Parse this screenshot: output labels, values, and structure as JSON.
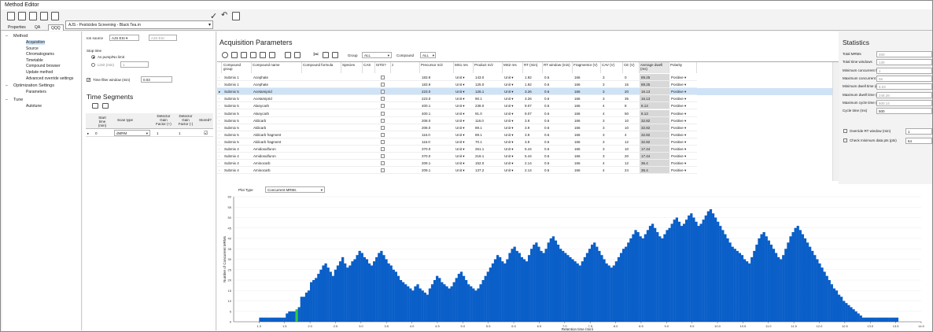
{
  "window_title": "Method Editor",
  "method_name": "AJS - Pesticides Screening - Black Tea.m",
  "tabs": [
    "Properties",
    "QA",
    "QQQ"
  ],
  "nav": [
    {
      "label": "Method",
      "level": 0,
      "expander": "–"
    },
    {
      "label": "Acquisition",
      "level": 1,
      "selected": true
    },
    {
      "label": "Source",
      "level": 1
    },
    {
      "label": "Chromatograms",
      "level": 1
    },
    {
      "label": "Timetable",
      "level": 1
    },
    {
      "label": "Compound browser",
      "level": 1
    },
    {
      "label": "Update method",
      "level": 1
    },
    {
      "label": "Advanced override settings",
      "level": 1
    },
    {
      "label": "Optimization Settings",
      "level": 0,
      "expander": "–"
    },
    {
      "label": "Parameters",
      "level": 1
    },
    {
      "label": "Tune",
      "level": 0,
      "expander": "–"
    },
    {
      "label": "Autotune",
      "level": 1
    }
  ],
  "settings": {
    "ion_source_label": "Ion source",
    "ion_source_value": "AJS ESI",
    "ion_source_value2": "AJS ESI",
    "stop_time_label": "Stop time",
    "stop_opt1": "As pump/No limit",
    "stop_opt2": "Limit (min)",
    "stop_limit_value": "1",
    "time_filter_label": "Time filter window (min)",
    "time_filter_value": "0.03"
  },
  "time_segments": {
    "title": "Time Segments",
    "headers": [
      "Start time (min)",
      "Scan type",
      "Detector Gain Factor (+)",
      "Detector Gain Factor (-)",
      "Stored?"
    ],
    "row": {
      "start": "0",
      "scan": "dMRM",
      "gain_pos": "1",
      "gain_neg": "1",
      "stored": "☑"
    }
  },
  "acq": {
    "title": "Acquisition Parameters",
    "group_label": "Group",
    "group_value": "ALL",
    "compound_label": "Compound",
    "compound_value": "ALL",
    "headers": [
      "Compound group",
      "Compound name",
      "Compound formula",
      "Species",
      "CAS",
      "ISTD?",
      "z",
      "Precursor m/z",
      "MS1 res",
      "Product m/z",
      "MS2 res",
      "RT (min)",
      "RT window (min)",
      "Fragmentor (V)",
      "CAV (V)",
      "CE (V)",
      "Average dwell (ms)",
      "Polarity"
    ],
    "rows": [
      {
        "group": "Submix 1",
        "name": "Acephate",
        "prec": "183.9",
        "ms1": "Unit",
        "prod": "143.0",
        "ms2": "Unit",
        "rt": "1.92",
        "rtw": "0.6",
        "frag": "166",
        "cav": "3",
        "ce": "0",
        "dwell": "89.25",
        "pol": "Positive"
      },
      {
        "group": "Submix 1",
        "name": "Acephate",
        "prec": "183.9",
        "ms1": "Unit",
        "prod": "125.0",
        "ms2": "Unit",
        "rt": "1.92",
        "rtw": "0.6",
        "frag": "166",
        "cav": "3",
        "ce": "15",
        "dwell": "89.25",
        "pol": "Positive"
      },
      {
        "group": "Submix 5",
        "name": "Acetamiprid",
        "prec": "223.0",
        "ms1": "Unit",
        "prod": "126.1",
        "ms2": "Unit",
        "rt": "3.26",
        "rtw": "0.6",
        "frag": "166",
        "cav": "3",
        "ce": "20",
        "dwell": "16.13",
        "pol": "Positive",
        "selected": true
      },
      {
        "group": "Submix 5",
        "name": "Acetamiprid",
        "prec": "223.0",
        "ms1": "Unit",
        "prod": "90.1",
        "ms2": "Unit",
        "rt": "3.26",
        "rtw": "0.6",
        "frag": "166",
        "cav": "3",
        "ce": "35",
        "dwell": "16.13",
        "pol": "Positive"
      },
      {
        "group": "Submix 5",
        "name": "Alanycarb",
        "prec": "400.1",
        "ms1": "Unit",
        "prod": "238.0",
        "ms2": "Unit",
        "rt": "9.07",
        "rtw": "0.6",
        "frag": "166",
        "cav": "4",
        "ce": "8",
        "dwell": "8.13",
        "pol": "Positive"
      },
      {
        "group": "Submix 5",
        "name": "Alanycarb",
        "prec": "400.1",
        "ms1": "Unit",
        "prod": "91.0",
        "ms2": "Unit",
        "rt": "9.07",
        "rtw": "0.6",
        "frag": "166",
        "cav": "4",
        "ce": "50",
        "dwell": "8.13",
        "pol": "Positive"
      },
      {
        "group": "Submix 5",
        "name": "Aldicarb",
        "prec": "208.0",
        "ms1": "Unit",
        "prod": "116.0",
        "ms2": "Unit",
        "rt": "3.9",
        "rtw": "0.6",
        "frag": "166",
        "cav": "3",
        "ce": "10",
        "dwell": "32.82",
        "pol": "Positive"
      },
      {
        "group": "Submix 5",
        "name": "Aldicarb",
        "prec": "208.0",
        "ms1": "Unit",
        "prod": "89.1",
        "ms2": "Unit",
        "rt": "3.9",
        "rtw": "0.6",
        "frag": "166",
        "cav": "3",
        "ce": "10",
        "dwell": "32.82",
        "pol": "Positive"
      },
      {
        "group": "Submix 5",
        "name": "Aldicarb fragment",
        "prec": "116.0",
        "ms1": "Unit",
        "prod": "89.1",
        "ms2": "Unit",
        "rt": "3.9",
        "rtw": "0.6",
        "frag": "166",
        "cav": "3",
        "ce": "4",
        "dwell": "32.82",
        "pol": "Positive"
      },
      {
        "group": "Submix 5",
        "name": "Aldicarb fragment",
        "prec": "116.0",
        "ms1": "Unit",
        "prod": "70.1",
        "ms2": "Unit",
        "rt": "3.9",
        "rtw": "0.6",
        "frag": "166",
        "cav": "3",
        "ce": "12",
        "dwell": "32.82",
        "pol": "Positive"
      },
      {
        "group": "Submix 4",
        "name": "Amidosulfuron",
        "prec": "370.0",
        "ms1": "Unit",
        "prod": "261.1",
        "ms2": "Unit",
        "rt": "5.44",
        "rtw": "0.6",
        "frag": "166",
        "cav": "3",
        "ce": "10",
        "dwell": "17.44",
        "pol": "Positive"
      },
      {
        "group": "Submix 4",
        "name": "Amidosulfuron",
        "prec": "370.0",
        "ms1": "Unit",
        "prod": "218.1",
        "ms2": "Unit",
        "rt": "5.44",
        "rtw": "0.6",
        "frag": "166",
        "cav": "3",
        "ce": "20",
        "dwell": "17.44",
        "pol": "Positive"
      },
      {
        "group": "Submix 4",
        "name": "Aminocarb",
        "prec": "209.1",
        "ms1": "Unit",
        "prod": "152.0",
        "ms2": "Unit",
        "rt": "2.14",
        "rtw": "0.6",
        "frag": "166",
        "cav": "4",
        "ce": "12",
        "dwell": "36.4",
        "pol": "Positive"
      },
      {
        "group": "Submix 4",
        "name": "Aminocarb",
        "prec": "209.1",
        "ms1": "Unit",
        "prod": "137.2",
        "ms2": "Unit",
        "rt": "2.14",
        "rtw": "0.6",
        "frag": "166",
        "cav": "4",
        "ce": "24",
        "dwell": "36.4",
        "pol": "Positive"
      }
    ]
  },
  "stats": {
    "title": "Statistics",
    "rows": [
      {
        "label": "Total MRMs",
        "value": "400"
      },
      {
        "label": "Total time windows",
        "value": "130"
      },
      {
        "label": "Minimum concurrent MRMs",
        "value": "2"
      },
      {
        "label": "Maximum concurrent MRMs",
        "value": "56"
      },
      {
        "label": "Minimum dwell time (ms)",
        "value": "8.03"
      },
      {
        "label": "Maximum dwell time (ms)",
        "value": "248.28"
      },
      {
        "label": "Maximum cycle time (ms)",
        "value": "500.14"
      },
      {
        "label": "Cycle time (ms)",
        "value": "500",
        "active": true
      }
    ],
    "override_label": "Override RT window (min)",
    "override_value": "1",
    "check_label": "Check minimum data pts (pts)",
    "check_value": "64"
  },
  "plot": {
    "type_label": "Plot Type",
    "type_value": "Concurrent MRMs"
  },
  "colors": {
    "bar": "#0a5fc8",
    "highlight": "#2ecc40",
    "selection": "#cfe3f7"
  },
  "chart_data": {
    "type": "bar",
    "xlabel": "Retention time (min)",
    "ylabel": "Number of Concurrent MRMs",
    "xlim": [
      0.5,
      14.0
    ],
    "ylim": [
      0,
      60
    ],
    "yticks": [
      0,
      5,
      10,
      15,
      20,
      25,
      30,
      35,
      40,
      45,
      50,
      55,
      60
    ],
    "xticks": [
      "1.0",
      "1.5",
      "2.0",
      "2.5",
      "3.0",
      "3.5",
      "4.0",
      "4.5",
      "5.0",
      "5.5",
      "6.0",
      "6.5",
      "7.0",
      "7.5",
      "8.0",
      "8.5",
      "9.0",
      "9.5",
      "10.0",
      "10.5",
      "11.0",
      "11.5",
      "12.0",
      "12.5",
      "13.0",
      "13.5",
      "14.0"
    ],
    "highlight_index": 15,
    "values": [
      2,
      2,
      2,
      2,
      2,
      2,
      2,
      2,
      2,
      2,
      2,
      4,
      5,
      5,
      5,
      6,
      7,
      12,
      12,
      14,
      15,
      19,
      20,
      21,
      23,
      25,
      27,
      28,
      26,
      24,
      22,
      25,
      27,
      29,
      31,
      28,
      26,
      27,
      29,
      30,
      32,
      34,
      33,
      31,
      30,
      28,
      27,
      29,
      31,
      33,
      34,
      32,
      30,
      28,
      27,
      25,
      24,
      22,
      20,
      19,
      18,
      17,
      16,
      15,
      17,
      18,
      16,
      15,
      14,
      13,
      16,
      18,
      20,
      22,
      21,
      19,
      18,
      17,
      16,
      17,
      19,
      21,
      23,
      24,
      22,
      20,
      18,
      17,
      16,
      15,
      16,
      18,
      20,
      22,
      24,
      26,
      28,
      30,
      32,
      31,
      29,
      28,
      30,
      33,
      35,
      36,
      34,
      33,
      31,
      30,
      29,
      32,
      35,
      37,
      38,
      36,
      34,
      33,
      35,
      38,
      40,
      41,
      39,
      37,
      35,
      34,
      33,
      32,
      31,
      30,
      29,
      28,
      27,
      29,
      31,
      33,
      35,
      37,
      38,
      36,
      34,
      32,
      30,
      28,
      27,
      26,
      27,
      29,
      31,
      33,
      35,
      36,
      38,
      40,
      42,
      44,
      43,
      41,
      40,
      42,
      44,
      46,
      47,
      45,
      43,
      41,
      40,
      42,
      44,
      45,
      47,
      49,
      50,
      48,
      46,
      47,
      49,
      51,
      52,
      50,
      48,
      46,
      47,
      49,
      51,
      53,
      54,
      52,
      50,
      48,
      46,
      44,
      42,
      40,
      38,
      36,
      35,
      34,
      33,
      32,
      30,
      29,
      28,
      31,
      34,
      37,
      40,
      42,
      43,
      41,
      39,
      37,
      35,
      33,
      31,
      30,
      32,
      35,
      38,
      41,
      43,
      45,
      46,
      44,
      42,
      40,
      38,
      36,
      34,
      32,
      30,
      28,
      26,
      24,
      22,
      20,
      18,
      16,
      15,
      13,
      12,
      10,
      9,
      8,
      7,
      6,
      5,
      4,
      3,
      2,
      2,
      2,
      2,
      2,
      2,
      2,
      2,
      2,
      2,
      2,
      2,
      2,
      2,
      2
    ]
  }
}
